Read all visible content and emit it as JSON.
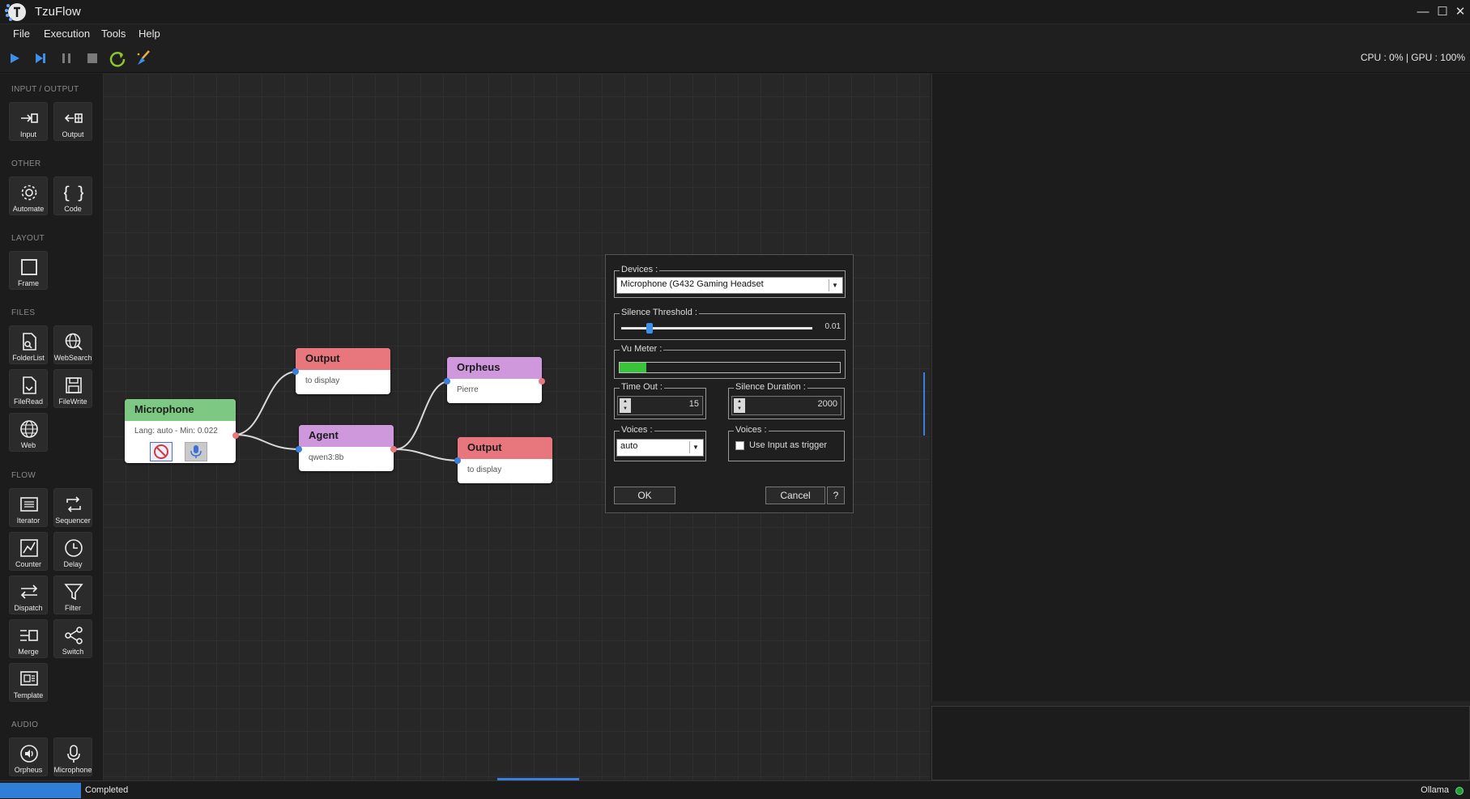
{
  "window": {
    "title": "TzuFlow",
    "minimize": "—",
    "maximize": "☐",
    "close": "✕"
  },
  "menu": [
    "File",
    "Execution",
    "Tools",
    "Help"
  ],
  "toolbar": {
    "run_icon": "play-icon",
    "step_icon": "step-icon",
    "pause_icon": "pause-icon",
    "stop_icon": "stop-icon",
    "reload_icon": "reload-icon",
    "clean_icon": "broom-icon",
    "cpu_label": "CPU : 0% | GPU : 100%"
  },
  "palette": {
    "sections": {
      "io": "INPUT / OUTPUT",
      "other": "OTHER",
      "layout": "LAYOUT",
      "files": "FILES",
      "flow": "FLOW",
      "audio": "AUDIO"
    },
    "tools": {
      "input": "Input",
      "output": "Output",
      "automate": "Automate",
      "code": "Code",
      "frame": "Frame",
      "folderlist": "FolderList",
      "websearch": "WebSearch",
      "fileread": "FileRead",
      "filewrite": "FileWrite",
      "web": "Web",
      "iterator": "Iterator",
      "sequencer": "Sequencer",
      "counter": "Counter",
      "delay": "Delay",
      "dispatch": "Dispatch",
      "filter": "Filter",
      "merge": "Merge",
      "switch": "Switch",
      "template": "Template",
      "orpheus": "Orpheus",
      "microphone": "Microphone"
    }
  },
  "nodes": {
    "microphone": {
      "title": "Microphone",
      "sub": "Lang: auto - Min: 0.022",
      "color": "#7dc883"
    },
    "output1": {
      "title": "Output",
      "sub": "to display",
      "color": "#e8777d"
    },
    "agent": {
      "title": "Agent",
      "sub": "qwen3:8b",
      "color": "#cf97dc"
    },
    "orpheus": {
      "title": "Orpheus",
      "sub": "Pierre",
      "color": "#cf97dc"
    },
    "output2": {
      "title": "Output",
      "sub": "to display",
      "color": "#e8777d"
    }
  },
  "dialog": {
    "devices_label": "Devices :",
    "device_value": "Microphone (G432 Gaming Headset",
    "silence_label": "Silence Threshold :",
    "silence_value": "0.01",
    "silence_level": 0.15,
    "vu_label": "Vu Meter :",
    "vu_level": 0.12,
    "timeout_label": "Time Out :",
    "timeout_value": "15",
    "duration_label": "Silence Duration :",
    "duration_value": "2000",
    "voices_label": "Voices :",
    "voices_value": "auto",
    "voices2_label": "Voices :",
    "trigger_label": "Use Input as trigger",
    "trigger_checked": false,
    "ok": "OK",
    "cancel": "Cancel",
    "help": "?"
  },
  "status": {
    "text": "Completed",
    "engine": "Ollama",
    "progress": 1.0
  }
}
